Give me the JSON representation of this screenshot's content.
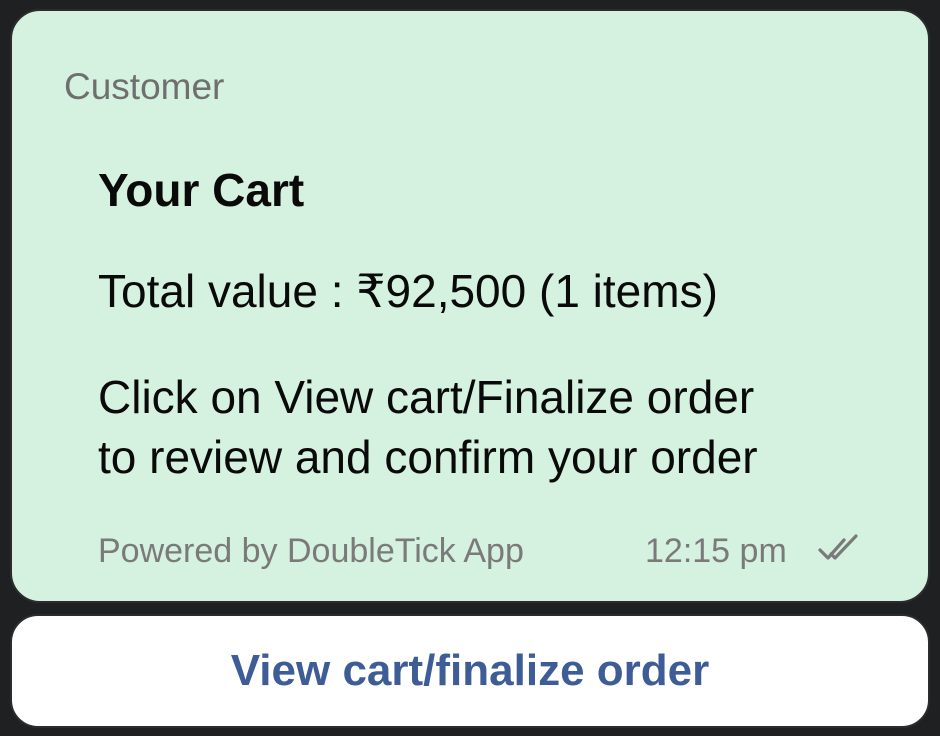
{
  "message": {
    "sender": "Customer",
    "title": "Your Cart",
    "total_line": "Total value : ₹92,500 (1 items)",
    "instruction_lines": [
      "Click on View cart/Finalize order",
      "to review and confirm your order"
    ],
    "powered_by": "Powered by DoubleTick App",
    "time": "12:15 pm",
    "status_icon": "double-check-icon"
  },
  "action": {
    "label": "View cart/finalize order"
  },
  "colors": {
    "bubble_bg": "#d5f1df",
    "button_text": "#3e5c96",
    "muted_text": "#7a7a7a",
    "frame": "#1f2022"
  }
}
